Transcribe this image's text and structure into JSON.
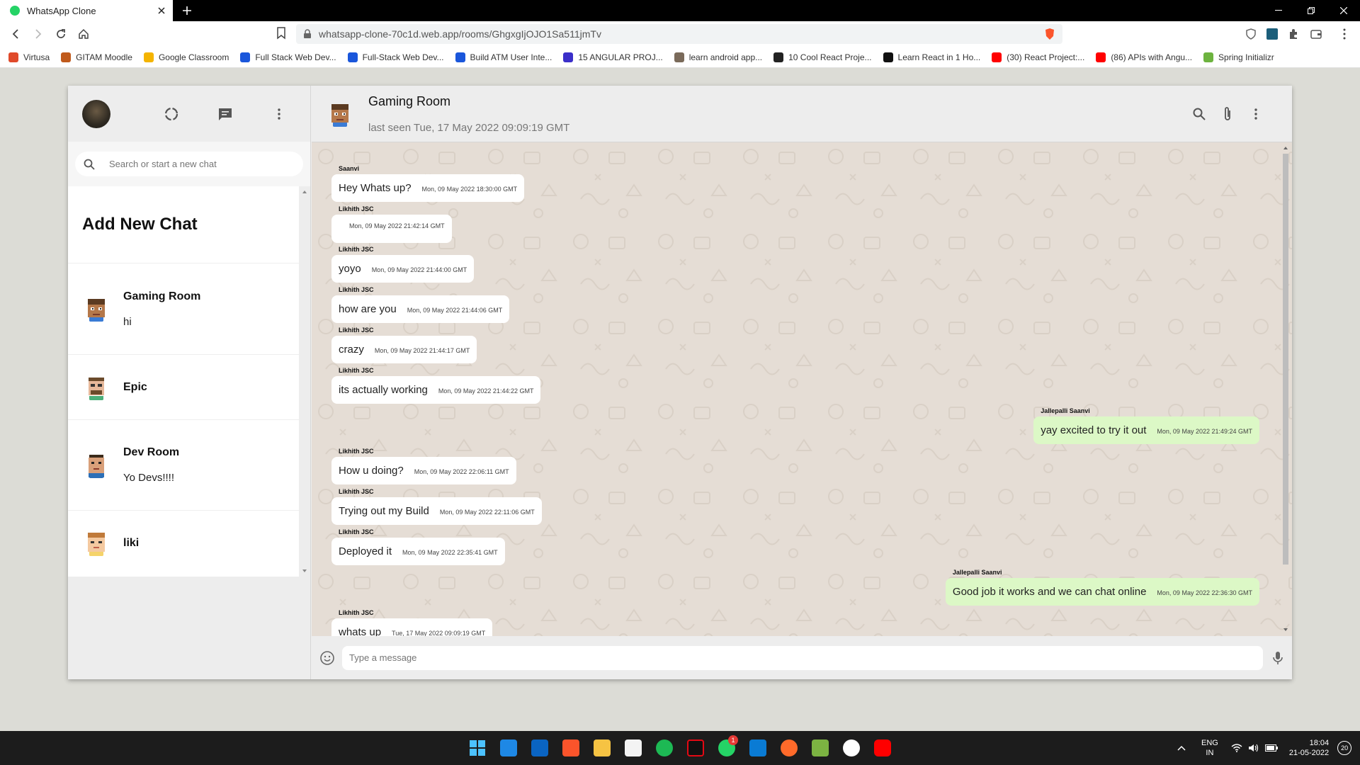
{
  "browser": {
    "tab_title": "WhatsApp Clone",
    "url": "whatsapp-clone-70c1d.web.app/rooms/GhgxgIjOJO1Sa511jmTv",
    "bookmarks": [
      {
        "label": "Virtusa",
        "color": "#e04a2a"
      },
      {
        "label": "GITAM Moodle",
        "color": "#c05a1c"
      },
      {
        "label": "Google Classroom",
        "color": "#f4b400"
      },
      {
        "label": "Full Stack Web Dev...",
        "color": "#1a56db"
      },
      {
        "label": "Full-Stack Web Dev...",
        "color": "#1a56db"
      },
      {
        "label": "Build ATM User Inte...",
        "color": "#1a56db"
      },
      {
        "label": "15 ANGULAR PROJ...",
        "color": "#3b2fc9"
      },
      {
        "label": "learn android app...",
        "color": "#7a6a5a"
      },
      {
        "label": "10 Cool React Proje...",
        "color": "#222222"
      },
      {
        "label": "Learn React in 1 Ho...",
        "color": "#111111"
      },
      {
        "label": "(30) React Project:...",
        "color": "#ff0000"
      },
      {
        "label": "(86) APIs with Angu...",
        "color": "#ff0000"
      },
      {
        "label": "Spring Initializr",
        "color": "#6db33f"
      }
    ]
  },
  "sidebar": {
    "search_placeholder": "Search or start a new chat",
    "add_new_chat": "Add New Chat",
    "chats": [
      {
        "name": "Gaming Room",
        "last": "hi"
      },
      {
        "name": "Epic",
        "last": ""
      },
      {
        "name": "Dev Room",
        "last": "Yo Devs!!!!"
      },
      {
        "name": "liki",
        "last": ""
      }
    ]
  },
  "chat": {
    "room_name": "Gaming Room",
    "last_seen": "last seen Tue, 17 May 2022 09:09:19 GMT",
    "input_placeholder": "Type a message",
    "messages": [
      {
        "sender": "Saanvi",
        "text": "Hey Whats up?",
        "time": "Mon, 09 May 2022 18:30:00 GMT",
        "sent": false
      },
      {
        "sender": "Likhith JSC",
        "text": "",
        "time": "Mon, 09 May 2022 21:42:14 GMT",
        "sent": false
      },
      {
        "sender": "Likhith JSC",
        "text": "yoyo",
        "time": "Mon, 09 May 2022 21:44:00 GMT",
        "sent": false
      },
      {
        "sender": "Likhith JSC",
        "text": "how are you",
        "time": "Mon, 09 May 2022 21:44:06 GMT",
        "sent": false
      },
      {
        "sender": "Likhith JSC",
        "text": "crazy",
        "time": "Mon, 09 May 2022 21:44:17 GMT",
        "sent": false
      },
      {
        "sender": "Likhith JSC",
        "text": "its actually working",
        "time": "Mon, 09 May 2022 21:44:22 GMT",
        "sent": false
      },
      {
        "sender": "Jallepalli Saanvi",
        "text": "yay excited to try it out",
        "time": "Mon, 09 May 2022 21:49:24 GMT",
        "sent": true
      },
      {
        "sender": "Likhith JSC",
        "text": "How u doing?",
        "time": "Mon, 09 May 2022 22:06:11 GMT",
        "sent": false
      },
      {
        "sender": "Likhith JSC",
        "text": "Trying out my Build",
        "time": "Mon, 09 May 2022 22:11:06 GMT",
        "sent": false
      },
      {
        "sender": "Likhith JSC",
        "text": "Deployed it",
        "time": "Mon, 09 May 2022 22:35:41 GMT",
        "sent": false
      },
      {
        "sender": "Jallepalli Saanvi",
        "text": "Good job it works and we can chat online",
        "time": "Mon, 09 May 2022 22:36:30 GMT",
        "sent": true
      },
      {
        "sender": "Likhith JSC",
        "text": "whats up",
        "time": "Tue, 17 May 2022 09:09:19 GMT",
        "sent": false
      }
    ]
  },
  "taskbar": {
    "lang_line1": "ENG",
    "lang_line2": "IN",
    "time": "18:04",
    "date": "21-05-2022",
    "whatsapp_badge": "1",
    "notif_count": "20"
  },
  "colors": {
    "sent_bubble": "#dcf8c6",
    "chat_bg": "#e5ddd5",
    "panel": "#ededed"
  }
}
